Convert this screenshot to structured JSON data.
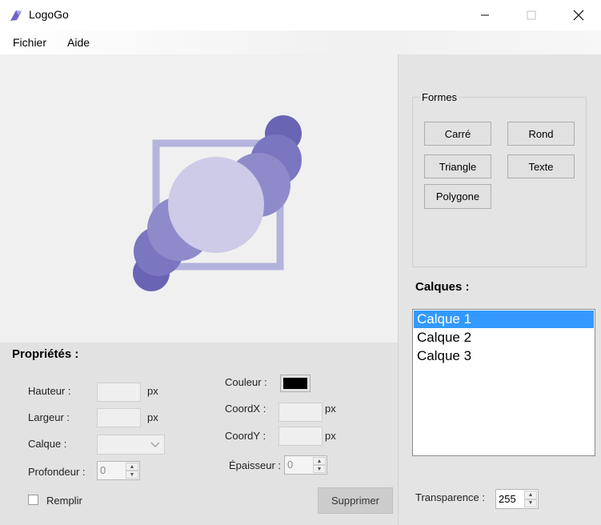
{
  "window": {
    "title": "LogoGo",
    "controls": {
      "minimize": "—",
      "maximize": "☐",
      "close": "✕"
    }
  },
  "menu": [
    {
      "label": "Fichier"
    },
    {
      "label": "Aide"
    }
  ],
  "properties": {
    "heading": "Propriétés :",
    "hauteur_label": "Hauteur :",
    "largeur_label": "Largeur :",
    "calque_label": "Calque :",
    "profondeur_label": "Profondeur :",
    "profondeur_value": "0",
    "remplir_label": "Remplir",
    "couleur_label": "Couleur :",
    "couleur_value": "#000000",
    "coordx_label": "CoordX :",
    "coordy_label": "CoordY :",
    "epaisseur_label": "Épaisseur :",
    "epaisseur_value": "0",
    "unit_px": "px",
    "supprimer_label": "Supprimer"
  },
  "shapes_group": {
    "title": "Formes",
    "buttons": [
      "Carré",
      "Rond",
      "Triangle",
      "Texte",
      "Polygone"
    ]
  },
  "layers": {
    "heading": "Calques :",
    "items": [
      "Calque 1",
      "Calque 2",
      "Calque 3"
    ],
    "selected_index": 0
  },
  "transparency": {
    "label": "Transparence :",
    "value": "255"
  },
  "colors": {
    "square_stroke": "#b3b3dd",
    "circle_dark": "#6a64b4",
    "circle_mid": "#7a76c0",
    "circle_light": "#8f8bcb",
    "circle_center": "#cdcbe8",
    "selection": "#3399ff"
  }
}
